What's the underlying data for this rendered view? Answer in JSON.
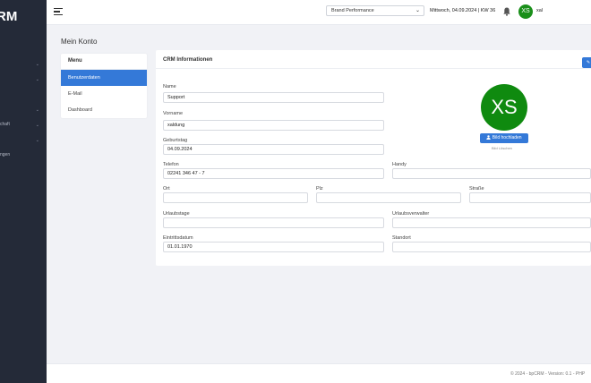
{
  "sidebar": {
    "logo": "RM",
    "items": [
      {
        "label": "",
        "chevron": "⌄"
      },
      {
        "label": "",
        "chevron": "⌄"
      },
      {
        "label": "",
        "chevron": "⌄"
      },
      {
        "label": "chaft",
        "chevron": "⌄"
      },
      {
        "label": "",
        "chevron": "⌄"
      },
      {
        "label": "ngen",
        "chevron": ""
      }
    ]
  },
  "topbar": {
    "select_value": "Brand Performance",
    "select_chevron": "⌄",
    "date": "Mittwoch, 04.09.2024 | KW 36",
    "avatar_initials": "XS",
    "username": "xal"
  },
  "page": {
    "title": "Mein Konto"
  },
  "menu": {
    "heading": "Menu",
    "items": [
      "Benutzerdaten",
      "E-Mail",
      "Dashboard"
    ]
  },
  "crm": {
    "heading": "CRM Informationen",
    "top_button": "✎",
    "fields": {
      "name": {
        "label": "Name",
        "value": "Support"
      },
      "vorname": {
        "label": "Vorname",
        "value": "xaldung"
      },
      "geburtstag": {
        "label": "Geburtstag",
        "value": "04.09.2024"
      },
      "telefon": {
        "label": "Telefon",
        "value": "02241 346 47 - 7"
      },
      "handy": {
        "label": "Handy",
        "value": ""
      },
      "ort": {
        "label": "Ort",
        "value": ""
      },
      "plz": {
        "label": "Plz",
        "value": ""
      },
      "strasse": {
        "label": "Straße",
        "value": ""
      },
      "urlaubstage": {
        "label": "Urlaubstage",
        "value": ""
      },
      "urlaubsverwalter": {
        "label": "Urlaubsverwalter",
        "value": ""
      },
      "eintrittsdatum": {
        "label": "Eintrittsdatum",
        "value": "01.01.1970"
      },
      "standort": {
        "label": "Standort",
        "value": ""
      }
    },
    "avatar_initials": "XS",
    "upload_button": "Bild hochladen",
    "delete_link": "Bild Löschen"
  },
  "footer": {
    "text": "© 2024 - bpCRM - Version: 0.1 - PHP"
  },
  "colors": {
    "sidebar": "#242a38",
    "accent": "#3479d8",
    "avatar": "#0f8a0f"
  }
}
